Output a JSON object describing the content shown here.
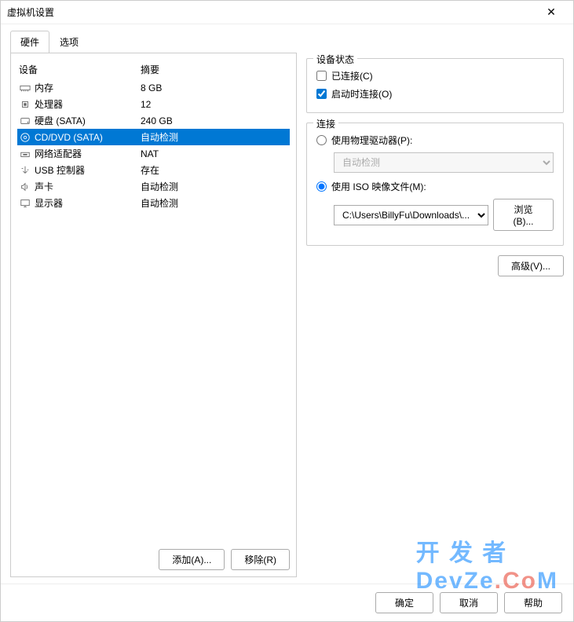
{
  "window": {
    "title": "虚拟机设置"
  },
  "tabs": {
    "hardware": "硬件",
    "options": "选项"
  },
  "hwHeader": {
    "device": "设备",
    "summary": "摘要"
  },
  "hardware": [
    {
      "icon": "memory",
      "name": "内存",
      "summary": "8 GB"
    },
    {
      "icon": "cpu",
      "name": "处理器",
      "summary": "12"
    },
    {
      "icon": "disk",
      "name": "硬盘 (SATA)",
      "summary": "240 GB"
    },
    {
      "icon": "cd",
      "name": "CD/DVD (SATA)",
      "summary": "自动检测",
      "selected": true
    },
    {
      "icon": "net",
      "name": "网络适配器",
      "summary": "NAT"
    },
    {
      "icon": "usb",
      "name": "USB 控制器",
      "summary": "存在"
    },
    {
      "icon": "sound",
      "name": "声卡",
      "summary": "自动检测"
    },
    {
      "icon": "display",
      "name": "显示器",
      "summary": "自动检测"
    }
  ],
  "hwButtons": {
    "add": "添加(A)...",
    "remove": "移除(R)"
  },
  "right": {
    "deviceState": {
      "legend": "设备状态",
      "connected": "已连接(C)",
      "connectedChecked": false,
      "connectOnStart": "启动时连接(O)",
      "connectOnStartChecked": true
    },
    "connection": {
      "legend": "连接",
      "usePhysical": "使用物理驱动器(P):",
      "physicalValue": "自动检测",
      "useIso": "使用 ISO 映像文件(M):",
      "isoPath": "C:\\Users\\BillyFu\\Downloads\\...",
      "browse": "浏览(B)..."
    },
    "advanced": "高级(V)..."
  },
  "footer": {
    "ok": "确定",
    "cancel": "取消",
    "help": "帮助"
  },
  "watermark": {
    "p1": "开 发 者",
    "p2": "DevZe",
    "p3": ".C",
    "p4": "M"
  }
}
